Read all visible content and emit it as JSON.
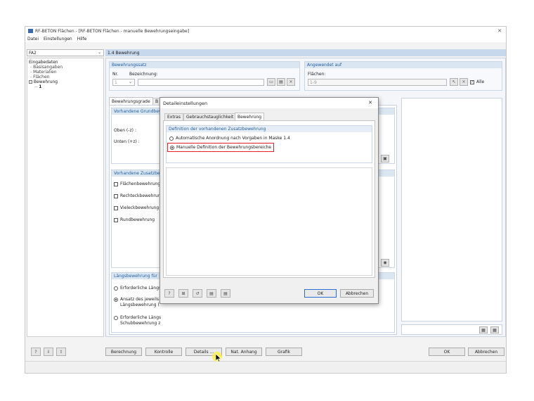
{
  "window": {
    "title": "RF-BETON Flächen - [RF-BETON Flächen - manuelle Bewehrungseingabe]",
    "close_glyph": "✕"
  },
  "menu": [
    "Datei",
    "Einstellungen",
    "Hilfe"
  ],
  "case_combo": {
    "value": "FA2"
  },
  "tree": {
    "root": "Eingabedaten",
    "items": [
      "Basisangaben",
      "Materialien",
      "Flächen",
      "Bewehrung"
    ],
    "sub_item": "1"
  },
  "section_title": "1.4 Bewehrung",
  "bewehrungssatz": {
    "header": "Bewehrungssatz",
    "nr_label": "Nr.",
    "bez_label": "Bezeichnung:",
    "nr_value": "1"
  },
  "angewendet": {
    "header": "Angewendet auf",
    "flaechen_label": "Flächen:",
    "flaechen_value": "1-9",
    "alle_label": "Alle"
  },
  "bg_tabs": [
    "Bewehrungsgrade",
    "B"
  ],
  "grundbew": {
    "header": "Vorhandene Grundbew",
    "oben": "Oben (-z) :",
    "unten": "Unten (+z) :"
  },
  "zusatz": {
    "header": "Vorhandene Zusatzbe",
    "items": [
      "Flächenbewehrung",
      "Rechteckbewehrun",
      "Vieleckbewehrung",
      "Rundbewehrung"
    ]
  },
  "laengs": {
    "header": "Längsbewehrung für",
    "opt1": "Erforderliche Längs",
    "opt2a": "Ansatz des jeweils",
    "opt2b": "Längsbewehrung (",
    "opt3a": "Erforderliche Längs",
    "opt3b": "Schubbewehrung z"
  },
  "bottom_buttons": [
    "Berechnung",
    "Kontrolle",
    "Details ...",
    "Nat. Anhang",
    "Grafik"
  ],
  "ok_label": "OK",
  "cancel_label": "Abbrechen",
  "dialog": {
    "title": "Detaileinstellungen",
    "close_glyph": "✕",
    "tabs": [
      "Extras",
      "Gebrauchstauglichkeit",
      "Bewehrung"
    ],
    "group_header": "Definition der vorhandenen Zusatzbewehrung",
    "option_auto": "Automatische Anordnung nach Vorgaben in Maske 1.4",
    "option_manual": "Manuelle Definition der Bewehrungsbereiche",
    "ok": "OK",
    "cancel": "Abbrechen"
  },
  "colors": {
    "header_blue": "#c8d8ec",
    "group_text": "#1f5c9e",
    "highlight_red": "#e3212b"
  }
}
